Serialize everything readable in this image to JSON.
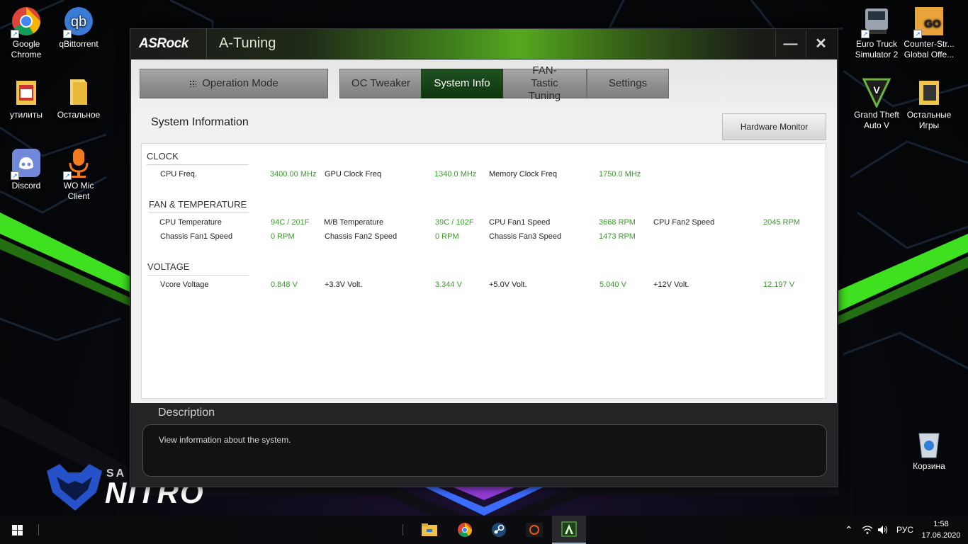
{
  "desktop": {
    "icons": [
      {
        "label": "Google Chrome"
      },
      {
        "label": "qBittorrent"
      },
      {
        "label": "утилиты"
      },
      {
        "label": "Остальное"
      },
      {
        "label": "Discord"
      },
      {
        "label": "WO Mic Client"
      },
      {
        "label": "Euro Truck Simulator 2"
      },
      {
        "label": "Counter-Str... Global Offe..."
      },
      {
        "label": "Grand Theft Auto V"
      },
      {
        "label": "Остальные Игры"
      },
      {
        "label": "Корзина"
      }
    ],
    "wallpaper_brand": "NITRO",
    "wallpaper_prefix": "SA"
  },
  "window": {
    "brand": "ASRock",
    "title": "A-Tuning",
    "controls": {
      "minimize": "—",
      "close": "✕"
    },
    "nav": {
      "operation_mode": "Operation Mode",
      "oc_tweaker": "OC Tweaker",
      "system_info": "System Info",
      "fan_tastic": "FAN-Tastic Tuning",
      "settings": "Settings"
    },
    "section_title": "System Information",
    "hardware_monitor": "Hardware Monitor",
    "groups": {
      "clock": {
        "title": "CLOCK",
        "items": [
          {
            "label": "CPU Freq.",
            "value": "3400.00 MHz"
          },
          {
            "label": "GPU Clock Freq",
            "value": "1340.0 MHz"
          },
          {
            "label": "Memory Clock Freq",
            "value": "1750.0 MHz"
          }
        ]
      },
      "fan": {
        "title": "FAN & TEMPERATURE",
        "items": [
          {
            "label": "CPU Temperature",
            "value": "94C / 201F"
          },
          {
            "label": "M/B Temperature",
            "value": "39C / 102F"
          },
          {
            "label": "CPU Fan1 Speed",
            "value": "3668 RPM"
          },
          {
            "label": "CPU Fan2 Speed",
            "value": "2045 RPM"
          },
          {
            "label": "Chassis Fan1 Speed",
            "value": "0 RPM"
          },
          {
            "label": "Chassis Fan2 Speed",
            "value": "0 RPM"
          },
          {
            "label": "Chassis Fan3 Speed",
            "value": "1473 RPM"
          }
        ]
      },
      "voltage": {
        "title": "VOLTAGE",
        "items": [
          {
            "label": "Vcore Voltage",
            "value": "0.848 V"
          },
          {
            "label": "+3.3V Volt.",
            "value": "3.344 V"
          },
          {
            "label": "+5.0V Volt.",
            "value": "5.040 V"
          },
          {
            "label": "+12V Volt.",
            "value": "12.197 V"
          }
        ]
      }
    },
    "description": {
      "title": "Description",
      "text": "View information about the system."
    }
  },
  "taskbar": {
    "apps": [
      "file-explorer",
      "google-chrome",
      "steam",
      "ryzen-master",
      "a-tuning"
    ],
    "tray": {
      "language": "РУС"
    },
    "clock": {
      "time": "1:58",
      "date": "17.06.2020"
    }
  },
  "colors": {
    "accent": "#1e4f1e",
    "value_green": "#3a9a2c",
    "wallpaper_neon": "#5bff2e"
  }
}
